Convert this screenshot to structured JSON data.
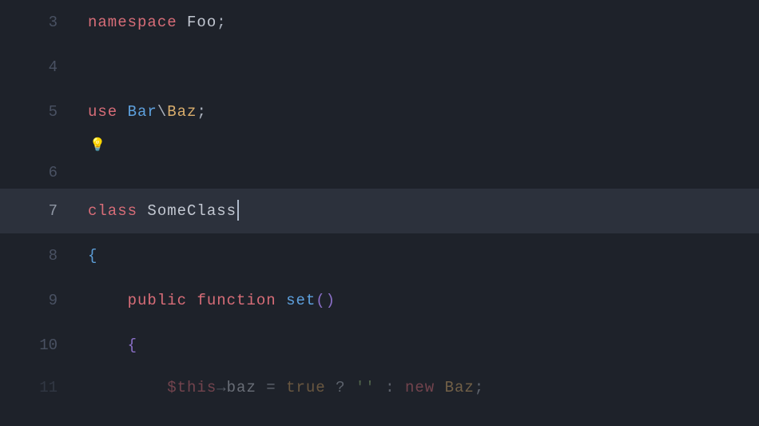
{
  "language": "php",
  "active_line": 7,
  "icons": {
    "bulb": "💡"
  },
  "lines": {
    "l3": {
      "num": "3",
      "kw": "namespace",
      "name": "Foo",
      "semi": ";"
    },
    "l4": {
      "num": "4"
    },
    "l5": {
      "num": "5",
      "kw": "use",
      "ns": "Bar",
      "sep": "\\",
      "cls": "Baz",
      "semi": ";"
    },
    "l6": {
      "num": "6"
    },
    "l7": {
      "num": "7",
      "kw": "class",
      "name": "SomeClass"
    },
    "l8": {
      "num": "8",
      "brace": "{"
    },
    "l9": {
      "num": "9",
      "vis": "public",
      "fn_kw": "function",
      "fn_name": "set",
      "parens": "()"
    },
    "l10": {
      "num": "10",
      "brace": "{"
    },
    "l11": {
      "num": "11",
      "var": "$this",
      "arrow": "→",
      "prop": "baz",
      "assign": " = ",
      "bool": "true",
      "tern1": " ? ",
      "str": "''",
      "tern2": " : ",
      "new_kw": "new",
      "cls": "Baz",
      "semi": ";"
    }
  }
}
